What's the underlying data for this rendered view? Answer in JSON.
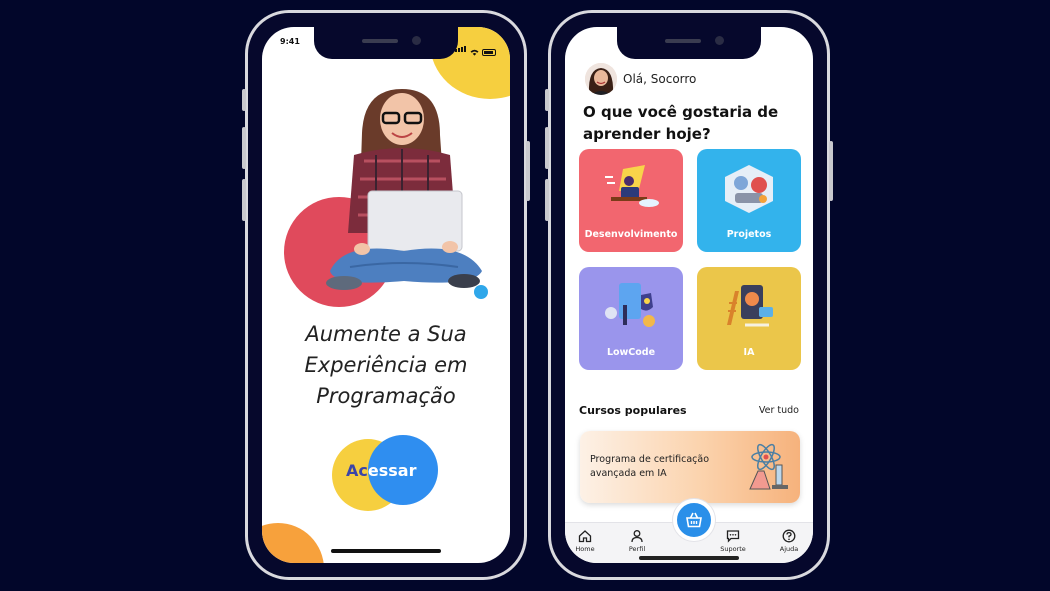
{
  "colors": {
    "background": "#02062a",
    "accent_blue": "#2f8ef0",
    "accent_yellow": "#f6cf3f",
    "accent_red": "#e04a5c",
    "accent_orange": "#f7a13c",
    "tile_desenvolvimento": "#f2666f",
    "tile_projetos": "#33b3ec",
    "tile_lowcode": "#9a95ec",
    "tile_ia": "#ebc64a"
  },
  "left_screen": {
    "status_time": "9:41",
    "headline": "Aumente a Sua\nExperiência em\nProgramação",
    "button_part1": "Ac",
    "button_part2": "essar"
  },
  "right_screen": {
    "greeting": "Olá, Socorro",
    "question": "O que você gostaria de aprender hoje?",
    "categories": [
      {
        "label": "Desenvolvimento",
        "icon": "developer-illustration-icon"
      },
      {
        "label": "Projetos",
        "icon": "robotics-illustration-icon"
      },
      {
        "label": "LowCode",
        "icon": "lowcode-illustration-icon"
      },
      {
        "label": "IA",
        "icon": "ai-illustration-icon"
      }
    ],
    "popular_title": "Cursos populares",
    "see_all": "Ver tudo",
    "course_title": "Programa de certificação avançada em IA",
    "tabs": [
      {
        "label": "Home",
        "icon": "home-icon"
      },
      {
        "label": "Perfil",
        "icon": "user-icon"
      },
      {
        "label": "Suporte",
        "icon": "chat-icon"
      },
      {
        "label": "Ajuda",
        "icon": "help-icon"
      }
    ],
    "fab_icon": "basket-icon"
  }
}
